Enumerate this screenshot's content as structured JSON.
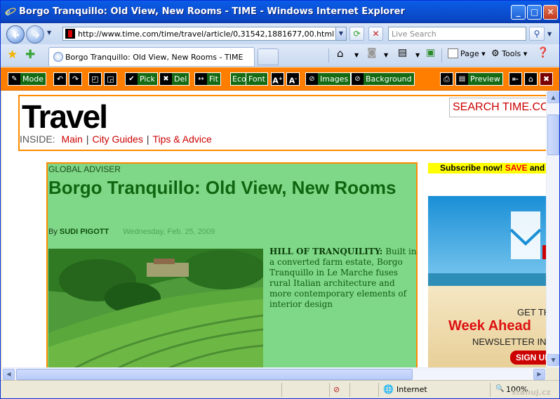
{
  "window": {
    "title": "Borgo Tranquillo: Old View, New Rooms - TIME - Windows Internet Explorer",
    "minimize": "_",
    "maximize": "□",
    "close": "✕"
  },
  "address_bar": {
    "url": "http://www.time.com/time/travel/article/0,31542,1881677,00.html",
    "search_placeholder": "Live Search"
  },
  "tab": {
    "title": "Borgo Tranquillo: Old View, New Rooms - TIME"
  },
  "command_bar": {
    "page_label": "Page",
    "tools_label": "Tools"
  },
  "editor_toolbar": {
    "mode": "Mode",
    "pick": "Pick",
    "del": "Del",
    "fit": "Fit",
    "eco": "Eco",
    "font": "Font",
    "images": "Images",
    "background": "Background",
    "preview": "Preview",
    "font_big_glyph": "A",
    "font_small_glyph": "A"
  },
  "site": {
    "logo": "Travel",
    "search": "SEARCH TIME.COM",
    "inside_label": "INSIDE:",
    "nav": [
      "Main",
      "City Guides",
      "Tips & Advice"
    ],
    "separator": "|"
  },
  "article": {
    "kicker": "GLOBAL ADVISER",
    "headline": "Borgo Tranquillo: Old View, New Rooms",
    "by": "By",
    "author": "SUDI PIGOTT",
    "date": "Wednesday, Feb. 25, 2009",
    "caption_lead": "HILL OF TRANQUILITY:",
    "caption_body": " Built in a converted farm estate, Borgo Tranquillo in Le Marche fuses rural Italian architecture and more contemporary elements of interior design"
  },
  "sidebar": {
    "subscribe_a": "Subscribe now! ",
    "subscribe_save": "SAVE",
    "subscribe_b": " and m",
    "ad_line1": "GET TH",
    "ad_line2": "Week Ahead",
    "ad_line3": "NEWSLETTER IN",
    "ad_button": "SIGN UP"
  },
  "status_bar": {
    "zone": "Internet",
    "zoom": "100%",
    "watermark": "stahuj.cz"
  },
  "colors": {
    "titlebar": "#0a52d6",
    "toolbar_orange": "#ff7e00",
    "highlight_green": "#7fd887",
    "headline_green": "#106510",
    "link_red": "#cc0000"
  }
}
